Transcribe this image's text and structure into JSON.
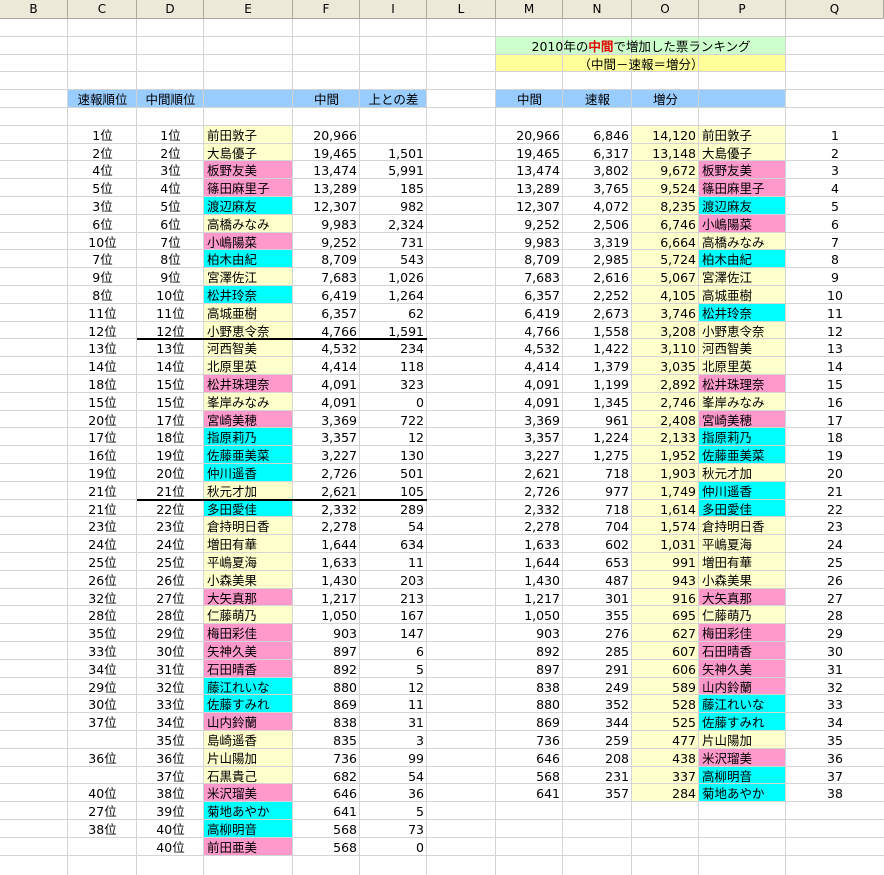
{
  "colors": {
    "yellow": "#ffffcc",
    "pink": "#ff99cc",
    "cyan": "#00ffff",
    "blue": "#99ccff",
    "green": "#ccffcc",
    "title_yellow": "#ffff99",
    "highlight": "#e00000"
  },
  "column_headers": [
    "B",
    "C",
    "D",
    "E",
    "F",
    "I",
    "L",
    "M",
    "N",
    "O",
    "P",
    "Q"
  ],
  "title": {
    "part1": "2010年の",
    "highlight": "中間",
    "part2": "で増加した票ランキング",
    "formula": "（中間－速報＝増分）"
  },
  "left_headers": {
    "sokuhou_rank": "速報順位",
    "chukan_rank": "中間順位",
    "chukan": "中間",
    "diff": "上との差"
  },
  "right_headers": {
    "chukan": "中間",
    "sokuhou": "速報",
    "zoubun": "増分"
  },
  "left_rows": [
    {
      "sr": "1位",
      "cr": "1位",
      "name": "前田敦子",
      "votes": "20,966",
      "diff": "",
      "color": "yellow"
    },
    {
      "sr": "2位",
      "cr": "2位",
      "name": "大島優子",
      "votes": "19,465",
      "diff": "1,501",
      "color": "yellow"
    },
    {
      "sr": "4位",
      "cr": "3位",
      "name": "板野友美",
      "votes": "13,474",
      "diff": "5,991",
      "color": "pink"
    },
    {
      "sr": "5位",
      "cr": "4位",
      "name": "篠田麻里子",
      "votes": "13,289",
      "diff": "185",
      "color": "pink"
    },
    {
      "sr": "3位",
      "cr": "5位",
      "name": "渡辺麻友",
      "votes": "12,307",
      "diff": "982",
      "color": "cyan"
    },
    {
      "sr": "6位",
      "cr": "6位",
      "name": "高橋みなみ",
      "votes": "9,983",
      "diff": "2,324",
      "color": "yellow"
    },
    {
      "sr": "10位",
      "cr": "7位",
      "name": "小嶋陽菜",
      "votes": "9,252",
      "diff": "731",
      "color": "pink"
    },
    {
      "sr": "7位",
      "cr": "8位",
      "name": "柏木由紀",
      "votes": "8,709",
      "diff": "543",
      "color": "cyan"
    },
    {
      "sr": "9位",
      "cr": "9位",
      "name": "宮澤佐江",
      "votes": "7,683",
      "diff": "1,026",
      "color": "yellow"
    },
    {
      "sr": "8位",
      "cr": "10位",
      "name": "松井玲奈",
      "votes": "6,419",
      "diff": "1,264",
      "color": "cyan"
    },
    {
      "sr": "11位",
      "cr": "11位",
      "name": "高城亜樹",
      "votes": "6,357",
      "diff": "62",
      "color": "yellow"
    },
    {
      "sr": "12位",
      "cr": "12位",
      "name": "小野恵令奈",
      "votes": "4,766",
      "diff": "1,591",
      "color": "yellow"
    },
    {
      "sr": "13位",
      "cr": "13位",
      "name": "河西智美",
      "votes": "4,532",
      "diff": "234",
      "color": "yellow"
    },
    {
      "sr": "14位",
      "cr": "14位",
      "name": "北原里英",
      "votes": "4,414",
      "diff": "118",
      "color": "yellow"
    },
    {
      "sr": "18位",
      "cr": "15位",
      "name": "松井珠理奈",
      "votes": "4,091",
      "diff": "323",
      "color": "pink"
    },
    {
      "sr": "15位",
      "cr": "15位",
      "name": "峯岸みなみ",
      "votes": "4,091",
      "diff": "0",
      "color": "yellow"
    },
    {
      "sr": "20位",
      "cr": "17位",
      "name": "宮崎美穂",
      "votes": "3,369",
      "diff": "722",
      "color": "pink"
    },
    {
      "sr": "17位",
      "cr": "18位",
      "name": "指原莉乃",
      "votes": "3,357",
      "diff": "12",
      "color": "cyan"
    },
    {
      "sr": "16位",
      "cr": "19位",
      "name": "佐藤亜美菜",
      "votes": "3,227",
      "diff": "130",
      "color": "cyan"
    },
    {
      "sr": "19位",
      "cr": "20位",
      "name": "仲川遥香",
      "votes": "2,726",
      "diff": "501",
      "color": "cyan"
    },
    {
      "sr": "21位",
      "cr": "21位",
      "name": "秋元才加",
      "votes": "2,621",
      "diff": "105",
      "color": "yellow"
    },
    {
      "sr": "21位",
      "cr": "22位",
      "name": "多田愛佳",
      "votes": "2,332",
      "diff": "289",
      "color": "cyan"
    },
    {
      "sr": "23位",
      "cr": "23位",
      "name": "倉持明日香",
      "votes": "2,278",
      "diff": "54",
      "color": "yellow"
    },
    {
      "sr": "24位",
      "cr": "24位",
      "name": "増田有華",
      "votes": "1,644",
      "diff": "634",
      "color": "yellow"
    },
    {
      "sr": "25位",
      "cr": "25位",
      "name": "平嶋夏海",
      "votes": "1,633",
      "diff": "11",
      "color": "yellow"
    },
    {
      "sr": "26位",
      "cr": "26位",
      "name": "小森美果",
      "votes": "1,430",
      "diff": "203",
      "color": "yellow"
    },
    {
      "sr": "32位",
      "cr": "27位",
      "name": "大矢真那",
      "votes": "1,217",
      "diff": "213",
      "color": "pink"
    },
    {
      "sr": "28位",
      "cr": "28位",
      "name": "仁藤萌乃",
      "votes": "1,050",
      "diff": "167",
      "color": "yellow"
    },
    {
      "sr": "35位",
      "cr": "29位",
      "name": "梅田彩佳",
      "votes": "903",
      "diff": "147",
      "color": "pink"
    },
    {
      "sr": "33位",
      "cr": "30位",
      "name": "矢神久美",
      "votes": "897",
      "diff": "6",
      "color": "pink"
    },
    {
      "sr": "34位",
      "cr": "31位",
      "name": "石田晴香",
      "votes": "892",
      "diff": "5",
      "color": "pink"
    },
    {
      "sr": "29位",
      "cr": "32位",
      "name": "藤江れいな",
      "votes": "880",
      "diff": "12",
      "color": "cyan"
    },
    {
      "sr": "30位",
      "cr": "33位",
      "name": "佐藤すみれ",
      "votes": "869",
      "diff": "11",
      "color": "cyan"
    },
    {
      "sr": "37位",
      "cr": "34位",
      "name": "山内鈴蘭",
      "votes": "838",
      "diff": "31",
      "color": "pink"
    },
    {
      "sr": "",
      "cr": "35位",
      "name": "島崎遥香",
      "votes": "835",
      "diff": "3",
      "color": "yellow"
    },
    {
      "sr": "36位",
      "cr": "36位",
      "name": "片山陽加",
      "votes": "736",
      "diff": "99",
      "color": "yellow"
    },
    {
      "sr": "",
      "cr": "37位",
      "name": "石黒貴己",
      "votes": "682",
      "diff": "54",
      "color": "yellow"
    },
    {
      "sr": "40位",
      "cr": "38位",
      "name": "米沢瑠美",
      "votes": "646",
      "diff": "36",
      "color": "pink"
    },
    {
      "sr": "27位",
      "cr": "39位",
      "name": "菊地あやか",
      "votes": "641",
      "diff": "5",
      "color": "cyan"
    },
    {
      "sr": "38位",
      "cr": "40位",
      "name": "高柳明音",
      "votes": "568",
      "diff": "73",
      "color": "cyan"
    },
    {
      "sr": "",
      "cr": "40位",
      "name": "前田亜美",
      "votes": "568",
      "diff": "0",
      "color": "pink"
    }
  ],
  "right_rows": [
    {
      "m": "20,966",
      "n": "6,846",
      "o": "14,120",
      "name": "前田敦子",
      "rank": "1",
      "color": "yellow"
    },
    {
      "m": "19,465",
      "n": "6,317",
      "o": "13,148",
      "name": "大島優子",
      "rank": "2",
      "color": "yellow"
    },
    {
      "m": "13,474",
      "n": "3,802",
      "o": "9,672",
      "name": "板野友美",
      "rank": "3",
      "color": "pink"
    },
    {
      "m": "13,289",
      "n": "3,765",
      "o": "9,524",
      "name": "篠田麻里子",
      "rank": "4",
      "color": "pink"
    },
    {
      "m": "12,307",
      "n": "4,072",
      "o": "8,235",
      "name": "渡辺麻友",
      "rank": "5",
      "color": "cyan"
    },
    {
      "m": "9,252",
      "n": "2,506",
      "o": "6,746",
      "name": "小嶋陽菜",
      "rank": "6",
      "color": "pink"
    },
    {
      "m": "9,983",
      "n": "3,319",
      "o": "6,664",
      "name": "高橋みなみ",
      "rank": "7",
      "color": "yellow"
    },
    {
      "m": "8,709",
      "n": "2,985",
      "o": "5,724",
      "name": "柏木由紀",
      "rank": "8",
      "color": "cyan"
    },
    {
      "m": "7,683",
      "n": "2,616",
      "o": "5,067",
      "name": "宮澤佐江",
      "rank": "9",
      "color": "yellow"
    },
    {
      "m": "6,357",
      "n": "2,252",
      "o": "4,105",
      "name": "高城亜樹",
      "rank": "10",
      "color": "yellow"
    },
    {
      "m": "6,419",
      "n": "2,673",
      "o": "3,746",
      "name": "松井玲奈",
      "rank": "11",
      "color": "cyan"
    },
    {
      "m": "4,766",
      "n": "1,558",
      "o": "3,208",
      "name": "小野恵令奈",
      "rank": "12",
      "color": "yellow"
    },
    {
      "m": "4,532",
      "n": "1,422",
      "o": "3,110",
      "name": "河西智美",
      "rank": "13",
      "color": "yellow"
    },
    {
      "m": "4,414",
      "n": "1,379",
      "o": "3,035",
      "name": "北原里英",
      "rank": "14",
      "color": "yellow"
    },
    {
      "m": "4,091",
      "n": "1,199",
      "o": "2,892",
      "name": "松井珠理奈",
      "rank": "15",
      "color": "pink"
    },
    {
      "m": "4,091",
      "n": "1,345",
      "o": "2,746",
      "name": "峯岸みなみ",
      "rank": "16",
      "color": "yellow"
    },
    {
      "m": "3,369",
      "n": "961",
      "o": "2,408",
      "name": "宮崎美穂",
      "rank": "17",
      "color": "pink"
    },
    {
      "m": "3,357",
      "n": "1,224",
      "o": "2,133",
      "name": "指原莉乃",
      "rank": "18",
      "color": "cyan"
    },
    {
      "m": "3,227",
      "n": "1,275",
      "o": "1,952",
      "name": "佐藤亜美菜",
      "rank": "19",
      "color": "cyan"
    },
    {
      "m": "2,621",
      "n": "718",
      "o": "1,903",
      "name": "秋元才加",
      "rank": "20",
      "color": "yellow"
    },
    {
      "m": "2,726",
      "n": "977",
      "o": "1,749",
      "name": "仲川遥香",
      "rank": "21",
      "color": "cyan"
    },
    {
      "m": "2,332",
      "n": "718",
      "o": "1,614",
      "name": "多田愛佳",
      "rank": "22",
      "color": "cyan"
    },
    {
      "m": "2,278",
      "n": "704",
      "o": "1,574",
      "name": "倉持明日香",
      "rank": "23",
      "color": "yellow"
    },
    {
      "m": "1,633",
      "n": "602",
      "o": "1,031",
      "name": "平嶋夏海",
      "rank": "24",
      "color": "yellow"
    },
    {
      "m": "1,644",
      "n": "653",
      "o": "991",
      "name": "増田有華",
      "rank": "25",
      "color": "yellow"
    },
    {
      "m": "1,430",
      "n": "487",
      "o": "943",
      "name": "小森美果",
      "rank": "26",
      "color": "yellow"
    },
    {
      "m": "1,217",
      "n": "301",
      "o": "916",
      "name": "大矢真那",
      "rank": "27",
      "color": "pink"
    },
    {
      "m": "1,050",
      "n": "355",
      "o": "695",
      "name": "仁藤萌乃",
      "rank": "28",
      "color": "yellow"
    },
    {
      "m": "903",
      "n": "276",
      "o": "627",
      "name": "梅田彩佳",
      "rank": "29",
      "color": "pink"
    },
    {
      "m": "892",
      "n": "285",
      "o": "607",
      "name": "石田晴香",
      "rank": "30",
      "color": "pink"
    },
    {
      "m": "897",
      "n": "291",
      "o": "606",
      "name": "矢神久美",
      "rank": "31",
      "color": "pink"
    },
    {
      "m": "838",
      "n": "249",
      "o": "589",
      "name": "山内鈴蘭",
      "rank": "32",
      "color": "pink"
    },
    {
      "m": "880",
      "n": "352",
      "o": "528",
      "name": "藤江れいな",
      "rank": "33",
      "color": "cyan"
    },
    {
      "m": "869",
      "n": "344",
      "o": "525",
      "name": "佐藤すみれ",
      "rank": "34",
      "color": "cyan"
    },
    {
      "m": "736",
      "n": "259",
      "o": "477",
      "name": "片山陽加",
      "rank": "35",
      "color": "yellow"
    },
    {
      "m": "646",
      "n": "208",
      "o": "438",
      "name": "米沢瑠美",
      "rank": "36",
      "color": "pink"
    },
    {
      "m": "568",
      "n": "231",
      "o": "337",
      "name": "高柳明音",
      "rank": "37",
      "color": "cyan"
    },
    {
      "m": "641",
      "n": "357",
      "o": "284",
      "name": "菊地あやか",
      "rank": "38",
      "color": "cyan"
    }
  ]
}
